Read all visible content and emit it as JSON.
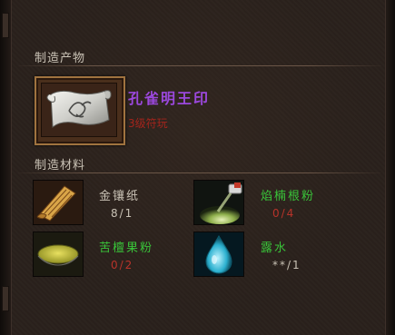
{
  "product_section": {
    "title": "制造产物",
    "item_name": "孔雀明王印",
    "item_subtitle": "3级符玩",
    "item_icon": "scroll-icon",
    "name_color": "#9b48dd",
    "subtitle_color": "#a3241c"
  },
  "materials_section": {
    "title": "制造材料",
    "items": [
      {
        "name": "金镶纸",
        "count": "8/1",
        "icon": "gold-paper-scroll-icon",
        "name_color": "#c9c2b5",
        "count_color": "#c9c2b5"
      },
      {
        "name": "焰楠根粉",
        "count": "0/4",
        "icon": "root-powder-icon",
        "name_color": "#39c339",
        "count_color": "#b8332a"
      },
      {
        "name": "苦檀果粉",
        "count": "0/2",
        "icon": "fruit-powder-bowl-icon",
        "name_color": "#39c339",
        "count_color": "#b8332a"
      },
      {
        "name": "露水",
        "count": "**/1",
        "icon": "water-drop-icon",
        "name_color": "#39c339",
        "count_color": "#c9c2b5"
      }
    ]
  }
}
